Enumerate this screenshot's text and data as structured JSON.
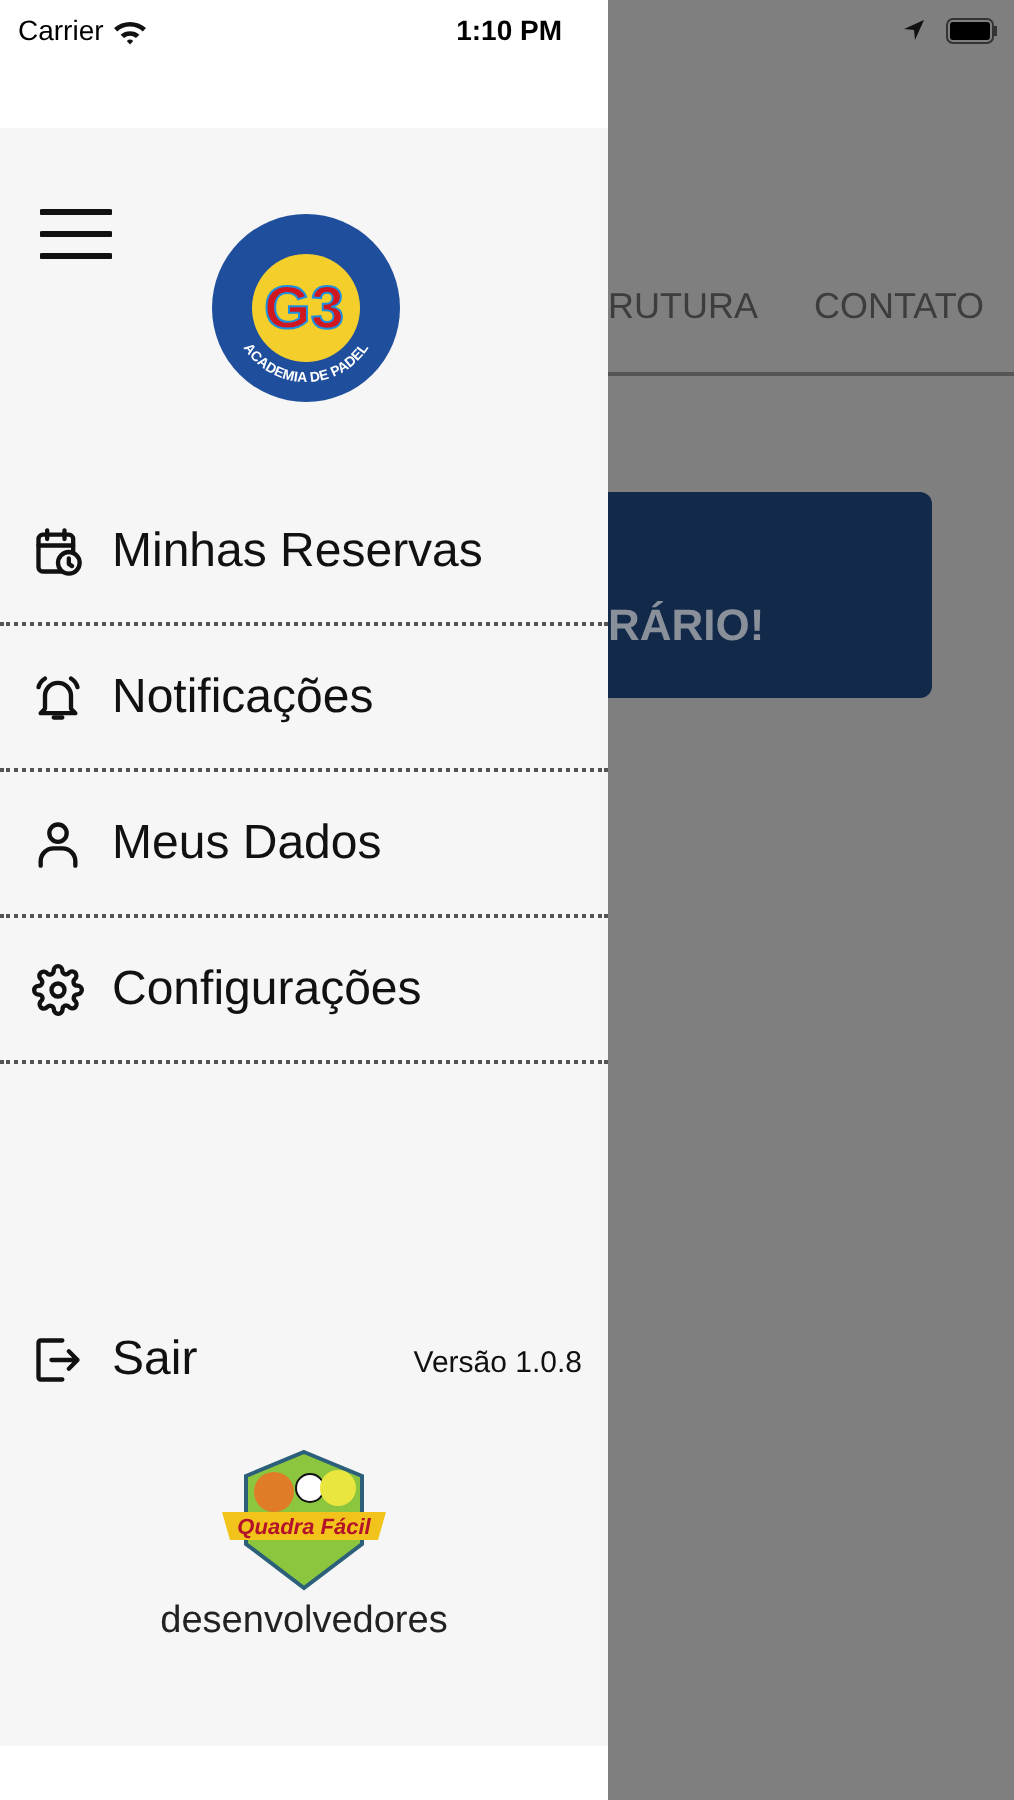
{
  "status_bar": {
    "carrier": "Carrier",
    "time": "1:10 PM"
  },
  "drawer": {
    "logo": {
      "mark": "G3",
      "caption": "ACADEMIA DE PADEL"
    },
    "menu": [
      {
        "kind": "calendar",
        "label": "Minhas Reservas"
      },
      {
        "kind": "bell",
        "label": "Notificações"
      },
      {
        "kind": "user",
        "label": "Meus Dados"
      },
      {
        "kind": "gear",
        "label": "Configurações"
      }
    ],
    "logout": {
      "label": "Sair"
    },
    "version": "Versão 1.0.8",
    "developer": {
      "logo_text": "Quadra Fácil",
      "caption": "desenvolvedores"
    }
  },
  "background": {
    "tabs": [
      "RUTURA",
      "CONTATO"
    ],
    "banner": "RÁRIO!"
  }
}
